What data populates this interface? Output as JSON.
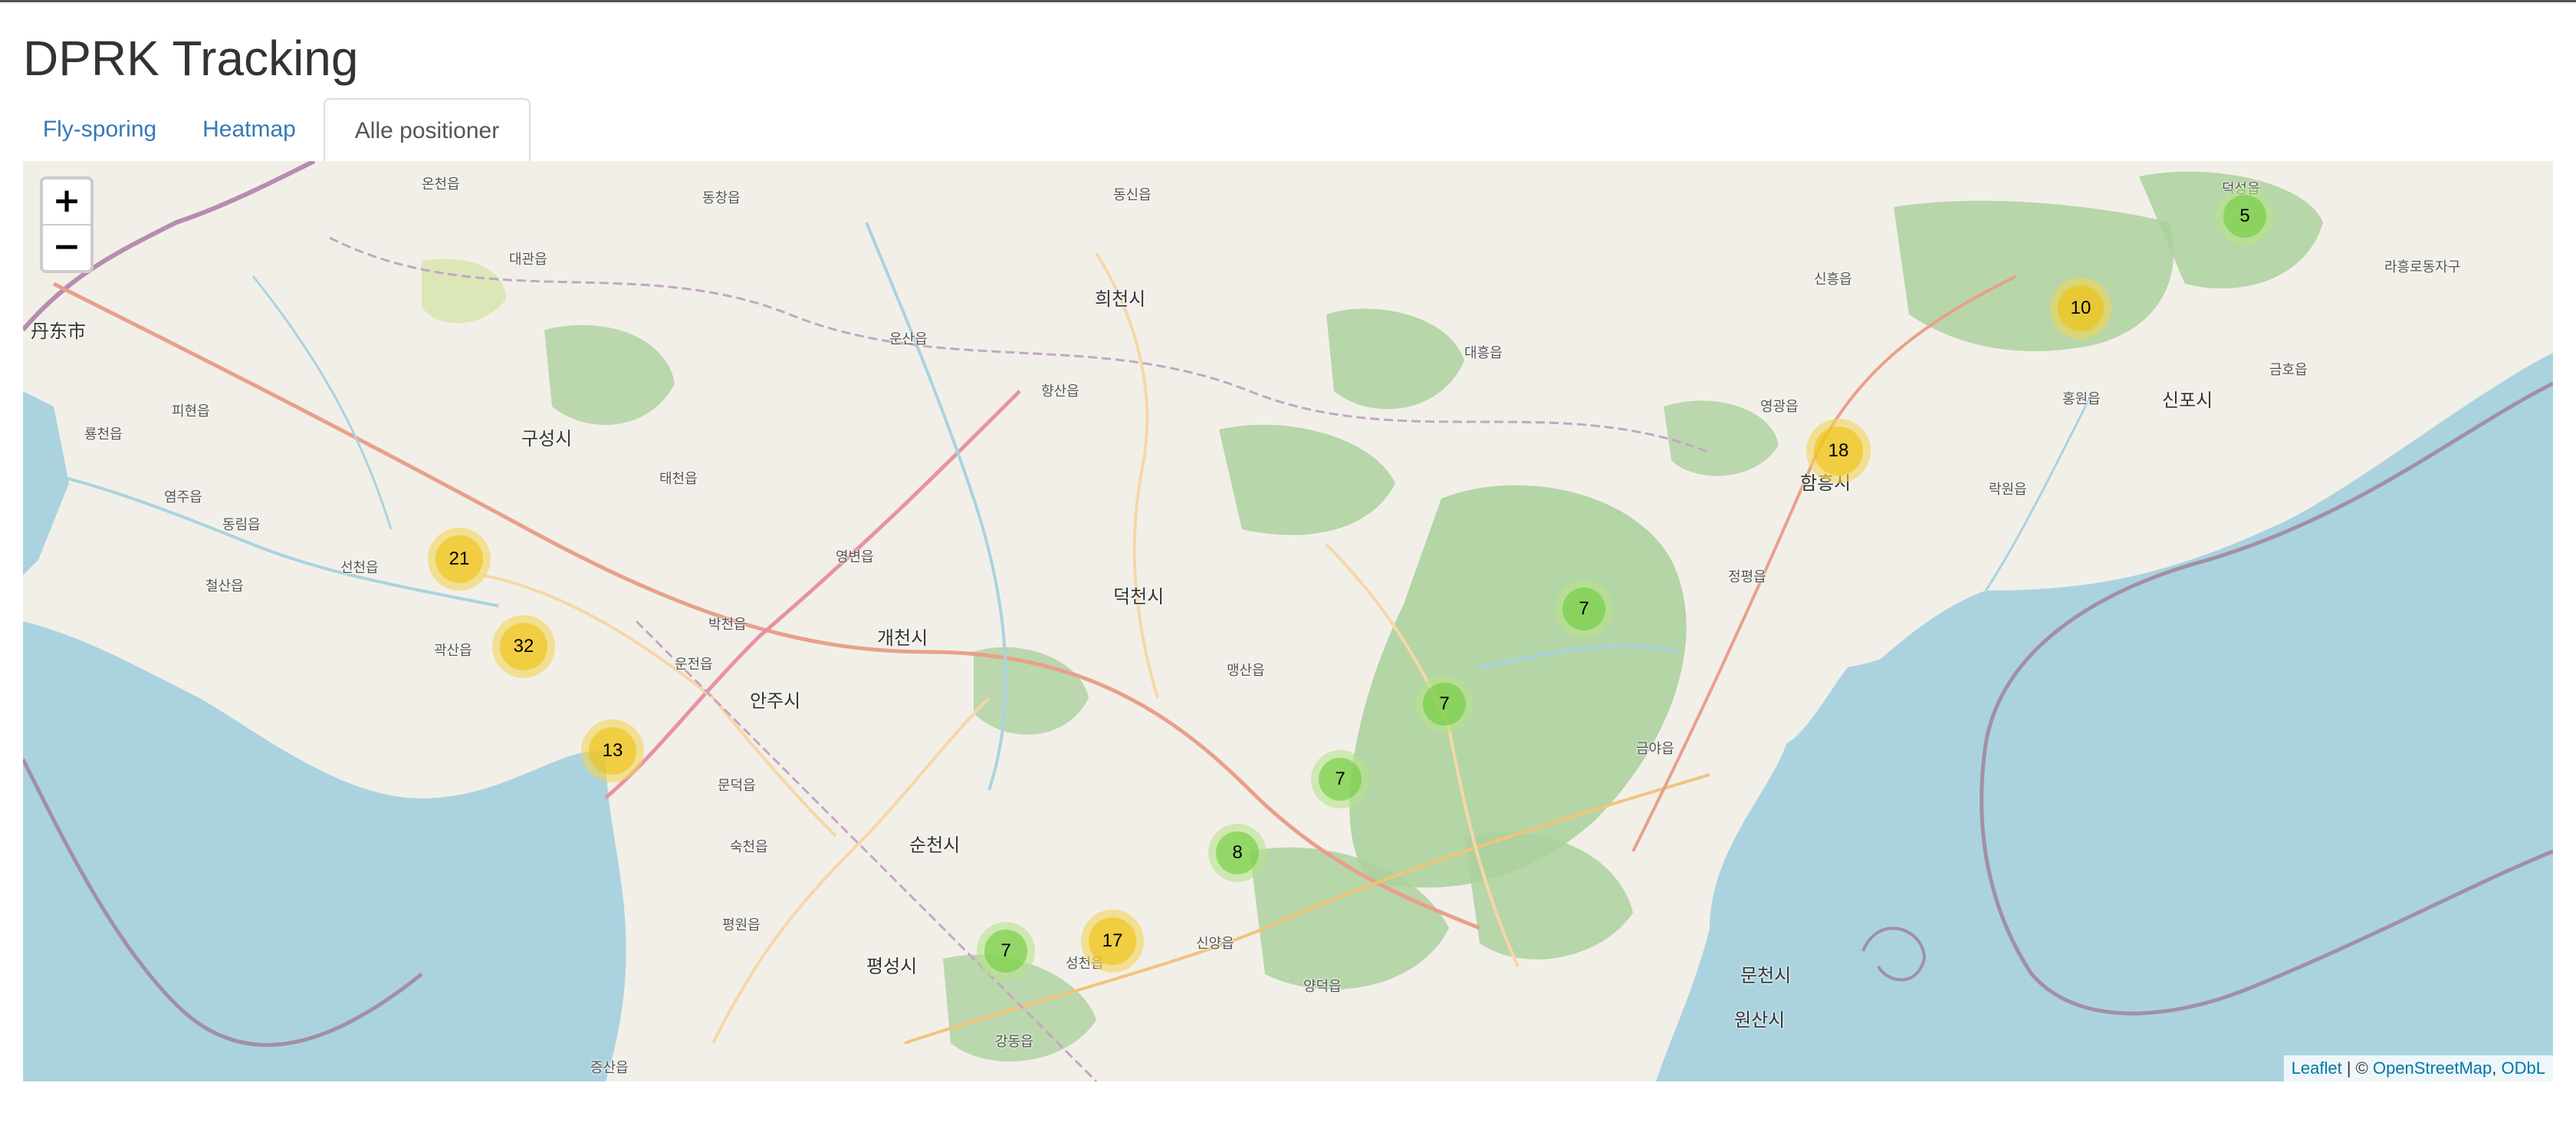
{
  "page": {
    "title": "DPRK Tracking"
  },
  "tabs": [
    {
      "label": "Fly-sporing",
      "active": false
    },
    {
      "label": "Heatmap",
      "active": false
    },
    {
      "label": "Alle positioner",
      "active": true
    }
  ],
  "map": {
    "zoom_in_label": "+",
    "zoom_out_label": "−",
    "clusters": [
      {
        "count": "5",
        "size": "small"
      },
      {
        "count": "10",
        "size": "medium"
      },
      {
        "count": "18",
        "size": "medium"
      },
      {
        "count": "21",
        "size": "medium"
      },
      {
        "count": "32",
        "size": "medium"
      },
      {
        "count": "13",
        "size": "medium"
      },
      {
        "count": "7",
        "size": "small"
      },
      {
        "count": "7",
        "size": "small"
      },
      {
        "count": "7",
        "size": "small"
      },
      {
        "count": "8",
        "size": "small"
      },
      {
        "count": "7",
        "size": "small"
      },
      {
        "count": "17",
        "size": "medium"
      }
    ],
    "place_labels": [
      "丹东市",
      "구성시",
      "희천시",
      "덕천시",
      "개천시",
      "안주시",
      "함흥시",
      "신포시",
      "순천시",
      "평성시",
      "문천시",
      "원산시",
      "향산읍",
      "박천읍",
      "운전읍",
      "곽산읍",
      "태천읍",
      "영변읍",
      "맹산읍",
      "영광읍",
      "홍원읍",
      "정평읍",
      "금야읍",
      "양덕읍",
      "신양읍",
      "성천읍",
      "강동읍",
      "숙천읍",
      "평원읍",
      "문덕읍",
      "증산읍",
      "철산읍",
      "선천읍",
      "피현읍",
      "룡천읍",
      "동림읍",
      "염주읍",
      "대관읍",
      "온천읍",
      "동창읍",
      "동신읍",
      "운산읍",
      "대흥읍",
      "신흥읍",
      "락원읍",
      "금호읍",
      "덕성읍",
      "라흥로동자구"
    ],
    "attribution": {
      "leaflet": "Leaflet",
      "sep": " | © ",
      "osm": "OpenStreetMap",
      "comma": ", ",
      "odbl": "ODbL"
    }
  }
}
